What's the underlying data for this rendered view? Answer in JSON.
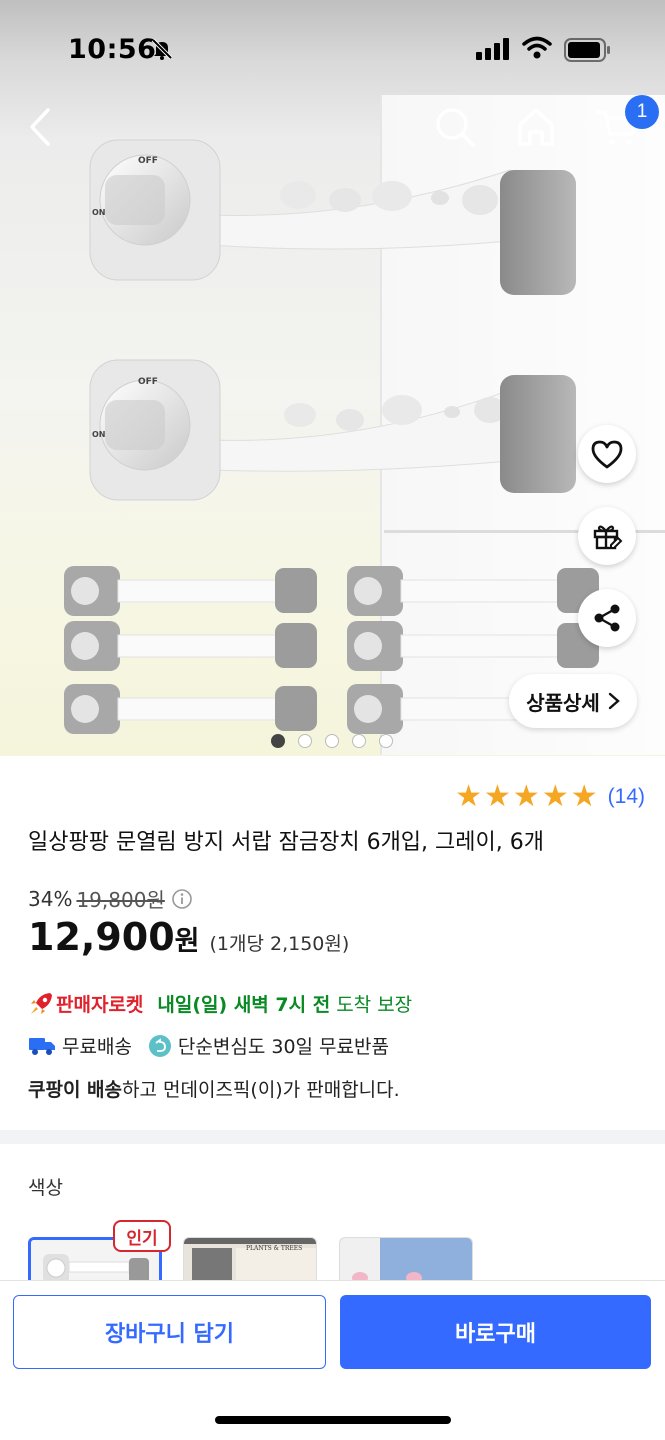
{
  "status_bar": {
    "time": "10:56"
  },
  "nav": {
    "cart_count": "1"
  },
  "product_image": {
    "lock_labels": {
      "off": "OFF",
      "on": "ON"
    },
    "carousel": {
      "total": 5,
      "active_index": 0
    },
    "detail_button_label": "상품상세"
  },
  "product": {
    "rating_stars": 5,
    "review_count": "(14)",
    "title": "일상팡팡 문열림 방지 서랍 잠금장치 6개입, 그레이, 6개",
    "discount_rate": "34%",
    "original_price": "19,800원",
    "price": "12,900",
    "price_currency": "원",
    "unit_price": "(1개당 2,150원)"
  },
  "delivery": {
    "rocket_label": "판매자로켓",
    "arrival": "내일(일) 새벽 7시 전",
    "arrival_tail": "도착 보장",
    "free_shipping": "무료배송",
    "free_return": "단순변심도 30일 무료반품",
    "seller_prefix": "쿠팡이 배송",
    "seller_suffix": "하고 먼데이즈픽(이)가 판매합니다."
  },
  "options": {
    "label": "색상",
    "popular_badge": "인기",
    "thumb3_text": "PLANTS & TREES"
  },
  "actions": {
    "add_to_cart": "장바구니 담기",
    "buy_now": "바로구매"
  },
  "colors": {
    "accent": "#346aff",
    "badge": "#2a6ff3",
    "rocket_red": "#e0222c",
    "delivery_green": "#0a8a25",
    "star": "#f5a623"
  }
}
